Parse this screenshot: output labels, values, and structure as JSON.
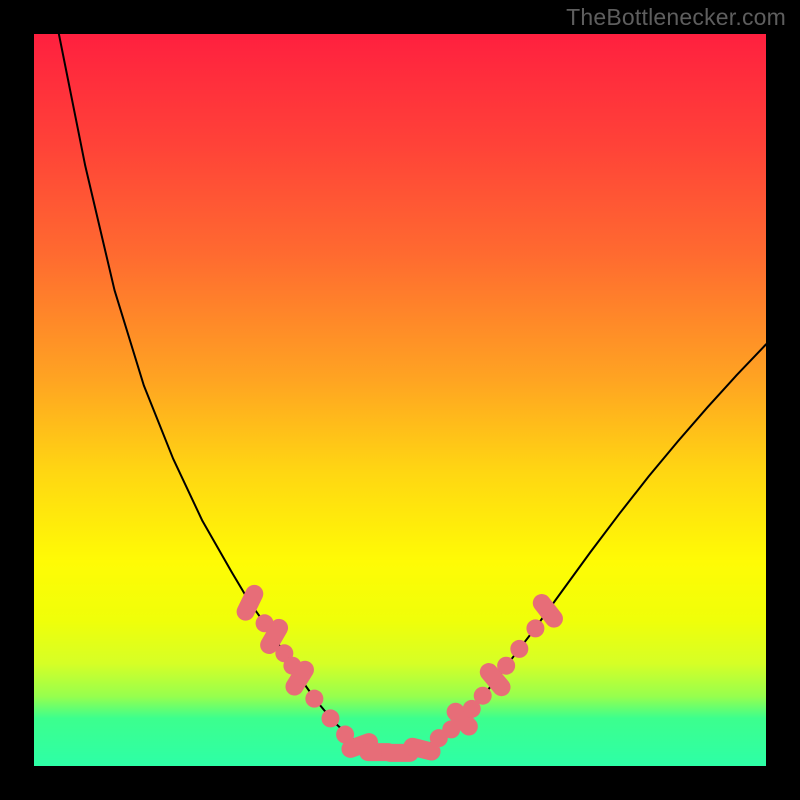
{
  "watermark": "TheBottlenecker.com",
  "chart_data": {
    "type": "line",
    "title": "",
    "subtitle": "",
    "xlabel": "",
    "ylabel": "",
    "x_range": [
      0,
      100
    ],
    "y_range": [
      0,
      100
    ],
    "background": {
      "type": "vertical-gradient",
      "stops": [
        {
          "offset": 0.0,
          "color": "#ff203f"
        },
        {
          "offset": 0.15,
          "color": "#ff4238"
        },
        {
          "offset": 0.3,
          "color": "#ff6a30"
        },
        {
          "offset": 0.47,
          "color": "#ffa322"
        },
        {
          "offset": 0.6,
          "color": "#ffd712"
        },
        {
          "offset": 0.72,
          "color": "#fffb05"
        },
        {
          "offset": 0.8,
          "color": "#f0ff09"
        },
        {
          "offset": 0.86,
          "color": "#d6ff26"
        },
        {
          "offset": 0.905,
          "color": "#96ff4e"
        },
        {
          "offset": 0.935,
          "color": "#3cff8e"
        },
        {
          "offset": 1.0,
          "color": "#2dffa6"
        }
      ],
      "green_band": {
        "y_top": 95.5,
        "y_bottom": 100
      },
      "yellow_band": {
        "y_top": 80,
        "y_bottom": 95.5
      }
    },
    "series": [
      {
        "name": "bottleneck-curve",
        "color": "#000000",
        "stroke_width": 2,
        "x": [
          3.4,
          7,
          11,
          15,
          19,
          23,
          27,
          29.5,
          31.5,
          33.5,
          36,
          38.5,
          41,
          43.5,
          47,
          52,
          55,
          57.5,
          60,
          62.5,
          65,
          68,
          72,
          76,
          80,
          84,
          88,
          92,
          96,
          100
        ],
        "y_pct_from_top": [
          0,
          18,
          35,
          48,
          58,
          66.5,
          73.5,
          77.7,
          80.5,
          83.5,
          87.5,
          91,
          94,
          96.3,
          98,
          98,
          96.5,
          94.5,
          92,
          89,
          85.7,
          81.8,
          76.3,
          70.8,
          65.5,
          60.4,
          55.6,
          51,
          46.6,
          42.4
        ]
      }
    ],
    "markers": {
      "color": "#e76d78",
      "radius": 9,
      "pill_width_factor": 2.1,
      "points": [
        {
          "x": 29.5,
          "y_pct": 77.7,
          "pill": true,
          "angle": -64
        },
        {
          "x": 31.5,
          "y_pct": 80.5
        },
        {
          "x": 32.8,
          "y_pct": 82.3,
          "pill": true,
          "angle": -60
        },
        {
          "x": 34.2,
          "y_pct": 84.6
        },
        {
          "x": 35.3,
          "y_pct": 86.3
        },
        {
          "x": 36.3,
          "y_pct": 88.0,
          "pill": true,
          "angle": -58
        },
        {
          "x": 38.3,
          "y_pct": 90.8
        },
        {
          "x": 40.5,
          "y_pct": 93.5
        },
        {
          "x": 42.5,
          "y_pct": 95.7
        },
        {
          "x": 44.5,
          "y_pct": 97.2,
          "pill": true,
          "angle": -20
        },
        {
          "x": 47.0,
          "y_pct": 98.1,
          "pill": true,
          "angle": 0
        },
        {
          "x": 50.0,
          "y_pct": 98.2,
          "pill": true,
          "angle": 0
        },
        {
          "x": 53.0,
          "y_pct": 97.7,
          "pill": true,
          "angle": 14
        },
        {
          "x": 55.3,
          "y_pct": 96.2
        },
        {
          "x": 57.0,
          "y_pct": 95.0
        },
        {
          "x": 58.5,
          "y_pct": 93.6,
          "pill": true,
          "angle": 48
        },
        {
          "x": 59.8,
          "y_pct": 92.2
        },
        {
          "x": 61.3,
          "y_pct": 90.4
        },
        {
          "x": 63.0,
          "y_pct": 88.2,
          "pill": true,
          "angle": 50
        },
        {
          "x": 64.5,
          "y_pct": 86.3
        },
        {
          "x": 66.3,
          "y_pct": 84.0
        },
        {
          "x": 68.5,
          "y_pct": 81.2
        },
        {
          "x": 70.2,
          "y_pct": 78.8,
          "pill": true,
          "angle": 52
        }
      ]
    }
  }
}
